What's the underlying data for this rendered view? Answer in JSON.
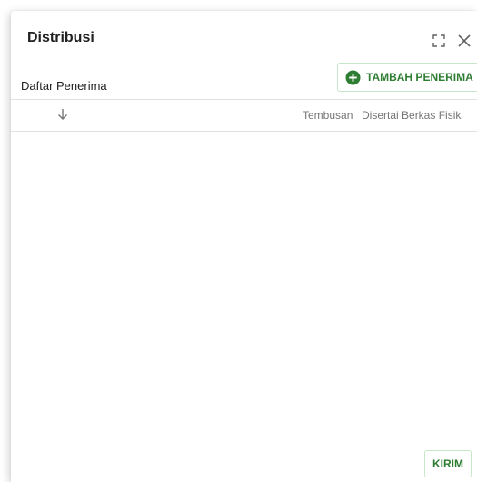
{
  "dialog": {
    "title": "Distribusi",
    "icons": {
      "fullscreen": "fullscreen-icon",
      "close": "close-icon"
    }
  },
  "recipients": {
    "label": "Daftar Penerima",
    "add_button_label": "TAMBAH PENERIMA",
    "add_button_icon": "plus-circle-icon"
  },
  "table": {
    "sort_icon": "arrow-down-icon",
    "columns": [
      "Tembusan",
      "Disertai Berkas Fisik"
    ],
    "rows": []
  },
  "footer": {
    "send_label": "KIRIM"
  },
  "colors": {
    "accent": "#2e7d32",
    "button_border": "#c8e6c9",
    "header_text": "#757575"
  }
}
